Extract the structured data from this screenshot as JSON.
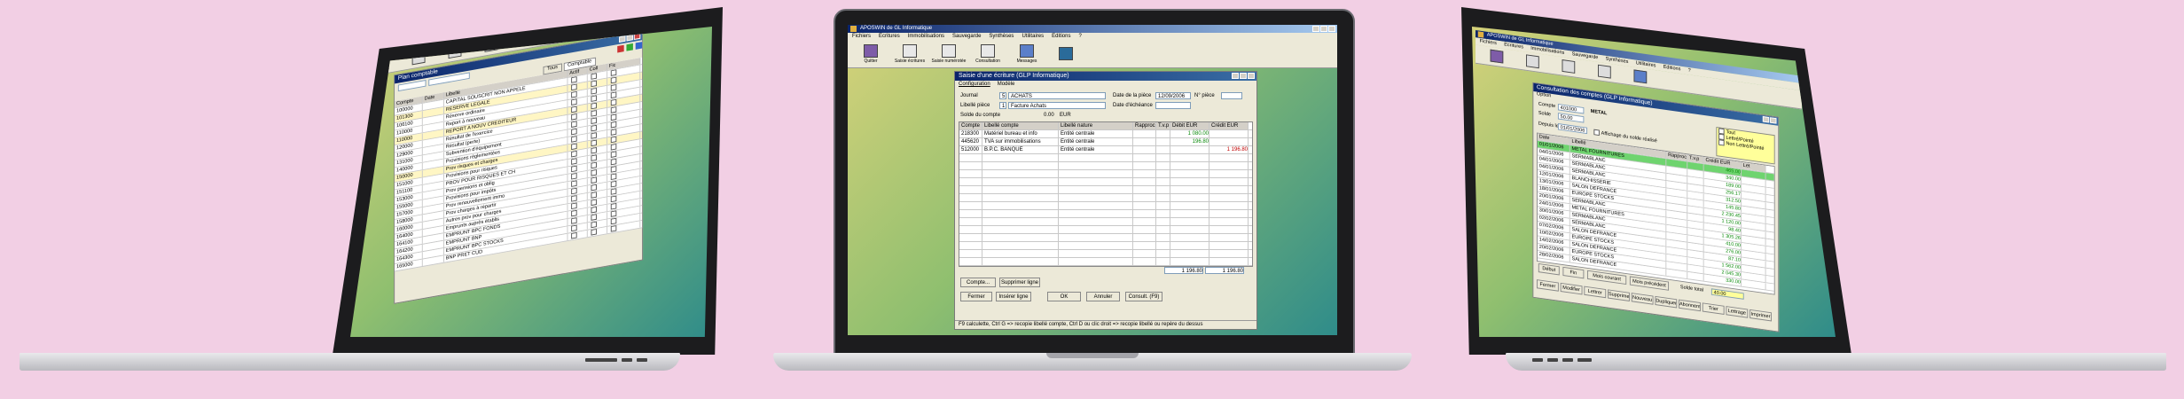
{
  "laptop_left": {
    "window": {
      "title": "Plan comptable",
      "tabs": [
        "Tous",
        "Comptable"
      ],
      "columns": [
        "Compte",
        "Date",
        "Libellé",
        "Actif",
        "Coll",
        "Fic"
      ],
      "rows": [
        [
          "100000",
          "",
          "CAPITAL SOUSCRIT NON APPELE"
        ],
        [
          "101300",
          "",
          "RESERVE LEGALE"
        ],
        [
          "106100",
          "",
          "Réserve ordinaire"
        ],
        [
          "110000",
          "",
          "Report à nouveau"
        ],
        [
          "110000",
          "",
          "REPORT A NOUV CREDITEUR"
        ],
        [
          "120000",
          "",
          "Résultat de l'exercice"
        ],
        [
          "129000",
          "",
          "Résultat (perte)"
        ],
        [
          "131000",
          "",
          "Subvention d'équipement"
        ],
        [
          "140000",
          "",
          "Provisions réglementées"
        ],
        [
          "150000",
          "",
          "Prov risques et charges"
        ],
        [
          "151000",
          "",
          "Provisions pour risques"
        ],
        [
          "151100",
          "",
          "PROV POUR RISQUES ET CH"
        ],
        [
          "153000",
          "",
          "Prov pensions et oblig"
        ],
        [
          "155000",
          "",
          "Provisions pour impôts"
        ],
        [
          "157000",
          "",
          "Prov renouvellement immo"
        ],
        [
          "158000",
          "",
          "Prov charges à répartir"
        ],
        [
          "160000",
          "",
          "Autres prov pour charges"
        ],
        [
          "164000",
          "",
          "Emprunts auprès établis"
        ],
        [
          "164100",
          "",
          "EMPRUNT BPC FONDS"
        ],
        [
          "164200",
          "",
          "EMPRUNT BNP"
        ],
        [
          "164300",
          "",
          "EMPRUNT BPC STOCKS"
        ],
        [
          "165000",
          "",
          "BNP PRET CUD"
        ]
      ]
    }
  },
  "laptop_middle": {
    "app": {
      "title": "APOSWIN de GL Informatique",
      "menu": [
        "Fichiers",
        "Ecritures",
        "Immobilisations",
        "Sauvegarde",
        "Synthèses",
        "Utilitaires",
        "Editions",
        "?"
      ],
      "toolbar": [
        "Quitter",
        "Saisie écritures",
        "Saisie numérotée",
        "Consultation",
        "Messages",
        ""
      ]
    },
    "entry_window": {
      "title": "Saisie d'une écriture (GLP Informatique)",
      "menu": [
        "Configuration",
        "Modèle"
      ],
      "labels": {
        "journal": "Journal",
        "date_piece": "Date de la pièce",
        "num_piece": "N° pièce",
        "libelle_piece": "Libellé pièce",
        "date_echeance": "Date d'échéance",
        "solde": "Solde du compte"
      },
      "journal_code": "5",
      "journal_value": "ACHATS",
      "libelle_code": "1",
      "libelle_value": "Facture Achats",
      "date_value": "12/09/2006",
      "solde_value": "0.00",
      "solde_unit": "EUR",
      "columns": [
        "Compte",
        "Libellé compte",
        "Libellé nature",
        "Rapproc",
        "T.v.p",
        "Débit EUR",
        "Crédit EUR"
      ],
      "rows": [
        {
          "compte": "218300",
          "libelle_compte": "Matériel bureau et info",
          "libelle_nature": "Entité centrale",
          "debit": "1 080.00",
          "credit": ""
        },
        {
          "compte": "445620",
          "libelle_compte": "TVA sur immobilisations",
          "libelle_nature": "Entité centrale",
          "debit": "196.80",
          "credit": ""
        },
        {
          "compte": "512000",
          "libelle_compte": "B.P.C. BANQUE",
          "libelle_nature": "Entité centrale",
          "debit": "",
          "credit": "1 196.80"
        }
      ],
      "total_debit": "1 196.80",
      "total_credit": "1 196.80",
      "buttons": {
        "compte": "Compte...",
        "supprimer": "Supprimer ligne",
        "fermer": "Fermer",
        "inserer": "Insérer ligne",
        "ok": "OK",
        "annuler": "Annuler",
        "consult": "Consult. (F9)"
      },
      "status": "F9 calculette,  Ctrl G => recopie libellé compte,  Ctrl D ou clic droit => recopie libellé ou repère du dessus"
    }
  },
  "laptop_right": {
    "app": {
      "title": "APOSWIN de GL Informatique",
      "menu": [
        "Fichiers",
        "Ecritures",
        "Immobilisations",
        "Sauvegarde",
        "Synthèses",
        "Utilitaires",
        "Editions",
        "?"
      ]
    },
    "window": {
      "title": "Consultation des comptes (GLP Informatique)",
      "menu": [
        "Option"
      ],
      "compte_label": "Compte",
      "compte_value": "401000",
      "compte_name": "METAL",
      "solde_label": "Solde",
      "solde_value": "50.00",
      "depuis_label": "Depuis le",
      "depuis_value": "01/01/2006",
      "affichage_label": "Affichage du solde réalisé",
      "options": [
        "Tout",
        "Lettré/Pointé",
        "Non Lettré/Pointé"
      ],
      "columns": [
        "Date",
        "Libellé",
        "Rapproc",
        "T.v.p",
        "Crédit EUR",
        "Let"
      ],
      "rows": [
        [
          "01/01/2006",
          "METAL FOURNITURES",
          "",
          "",
          "465.00"
        ],
        [
          "04/01/2006",
          "SERMABLANC",
          "",
          "",
          "340.00"
        ],
        [
          "04/01/2006",
          "SERMABLANC",
          "",
          "",
          "189.00"
        ],
        [
          "04/01/2006",
          "SERMABLANC",
          "",
          "",
          "256.17"
        ],
        [
          "12/01/2006",
          "BLANCHISSERIE",
          "",
          "",
          "312.50"
        ],
        [
          "13/01/2006",
          "SALON DEFRANCE",
          "",
          "",
          "145.80"
        ],
        [
          "18/01/2006",
          "EUROPE STOCKS",
          "",
          "",
          "2 230.45"
        ],
        [
          "20/01/2006",
          "SERMABLANC",
          "",
          "",
          "1 120.00"
        ],
        [
          "24/01/2006",
          "METAL FOURNITURES",
          "",
          "",
          "98.40"
        ],
        [
          "30/01/2006",
          "SERMABLANC",
          "",
          "",
          "1 305.26"
        ],
        [
          "02/02/2006",
          "SERMABLANC",
          "",
          "",
          "410.00"
        ],
        [
          "07/02/2006",
          "SALON DEFRANCE",
          "",
          "",
          "276.00"
        ],
        [
          "10/02/2006",
          "EUROPE STOCKS",
          "",
          "",
          "87.10"
        ],
        [
          "14/02/2006",
          "SALON DEFRANCE",
          "",
          "",
          "1 562.00"
        ],
        [
          "20/02/2006",
          "EUROPE STOCKS",
          "",
          "",
          "2 045.30"
        ],
        [
          "28/02/2006",
          "SALON DEFRANCE",
          "",
          "",
          "330.00"
        ]
      ],
      "buttons_row1": [
        "Début",
        "Fin",
        "Mois courant",
        "Mois précédent"
      ],
      "solde_total_label": "Solde total",
      "solde_total_value": "40.00",
      "buttons_row2": [
        "Fermer",
        "Modifier",
        "Lettrer",
        "Supprimer",
        "Nouveau",
        "Dupliquer",
        "Abonnement",
        "Trier",
        "Lettrage",
        "Imprimer"
      ]
    }
  }
}
